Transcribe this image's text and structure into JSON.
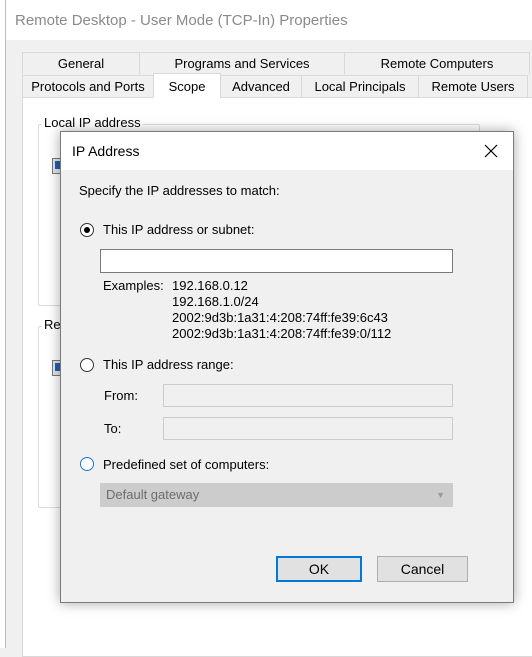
{
  "window": {
    "title": "Remote Desktop - User Mode (TCP-In) Properties"
  },
  "tabs_row1": [
    "General",
    "Programs and Services",
    "Remote Computers"
  ],
  "tabs_row2": [
    "Protocols and Ports",
    "Scope",
    "Advanced",
    "Local Principals",
    "Remote Users"
  ],
  "panel": {
    "local_group_label": "Local IP address",
    "remote_group_label": "Re"
  },
  "dialog": {
    "title": "IP Address",
    "prompt": "Specify the IP addresses to match:",
    "option_subnet": "This IP address or subnet:",
    "subnet_value": "",
    "examples_label": "Examples:",
    "examples": [
      "192.168.0.12",
      "192.168.1.0/24",
      "2002:9d3b:1a31:4:208:74ff:fe39:6c43",
      "2002:9d3b:1a31:4:208:74ff:fe39:0/112"
    ],
    "option_range": "This IP address range:",
    "from_label": "From:",
    "to_label": "To:",
    "from_value": "",
    "to_value": "",
    "option_predefined": "Predefined set of computers:",
    "predefined_selected": "Default gateway",
    "ok_label": "OK",
    "cancel_label": "Cancel",
    "selected_option": "subnet"
  },
  "colors": {
    "accent": "#0078d7"
  }
}
